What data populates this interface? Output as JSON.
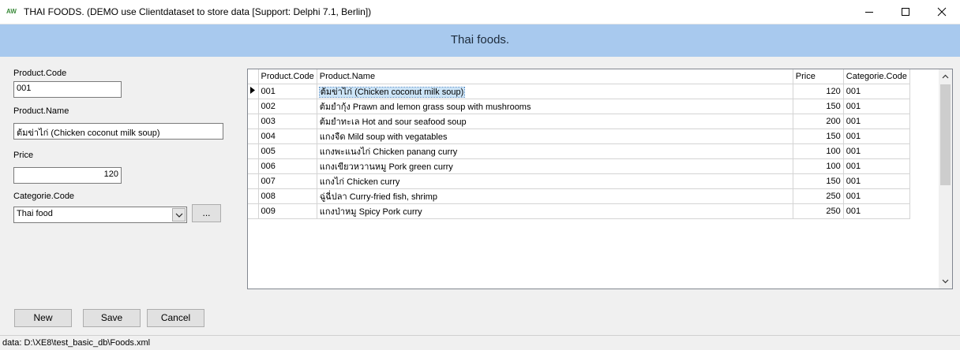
{
  "window": {
    "title": "THAI FOODS. (DEMO use Clientdataset to store data [Support: Delphi 7.1, Berlin])",
    "icon_text": "AW",
    "icons": {
      "minimize": "minimize-icon",
      "maximize": "maximize-icon",
      "close": "close-icon"
    }
  },
  "header": {
    "title": "Thai foods."
  },
  "form": {
    "product_code_label": "Product.Code",
    "product_code_value": "001",
    "product_name_label": "Product.Name",
    "product_name_value": "ต้มข่าไก่ (Chicken coconut milk soup)",
    "price_label": "Price",
    "price_value": "120",
    "category_label": "Categorie.Code",
    "category_value": "Thai food",
    "browse_label": "..."
  },
  "grid": {
    "columns": [
      "Product.Code",
      "Product.Name",
      "Price",
      "Categorie.Code"
    ],
    "rows": [
      [
        "001",
        "ต้มข่าไก่ (Chicken coconut milk soup)",
        "120",
        "001"
      ],
      [
        "002",
        "ต้มยำกุ้ง Prawn and lemon grass soup with mushrooms",
        "150",
        "001"
      ],
      [
        "003",
        "ต้มยำทะเล Hot and sour seafood soup",
        "200",
        "001"
      ],
      [
        "004",
        "แกงจืด Mild soup with vegatables",
        "150",
        "001"
      ],
      [
        "005",
        "แกงพะแนงไก่ Chicken panang curry",
        "100",
        "001"
      ],
      [
        "006",
        "แกงเขียวหวานหมู Pork green curry",
        "100",
        "001"
      ],
      [
        "007",
        "แกงไก่ Chicken curry",
        "150",
        "001"
      ],
      [
        "008",
        "ฉู่ฉี่ปลา Curry-fried fish, shrimp",
        "250",
        "001"
      ],
      [
        "009",
        "แกงป่าหมู Spicy Pork curry",
        "250",
        "001"
      ]
    ],
    "selected_row": 0
  },
  "buttons": {
    "new_label": "New",
    "save_label": "Save",
    "cancel_label": "Cancel"
  },
  "status": {
    "text": "data: D:\\XE8\\test_basic_db\\Foods.xml"
  },
  "colors": {
    "header_band": "#a8c9ee",
    "selection": "#cce4f7",
    "background": "#f0f0f0"
  }
}
